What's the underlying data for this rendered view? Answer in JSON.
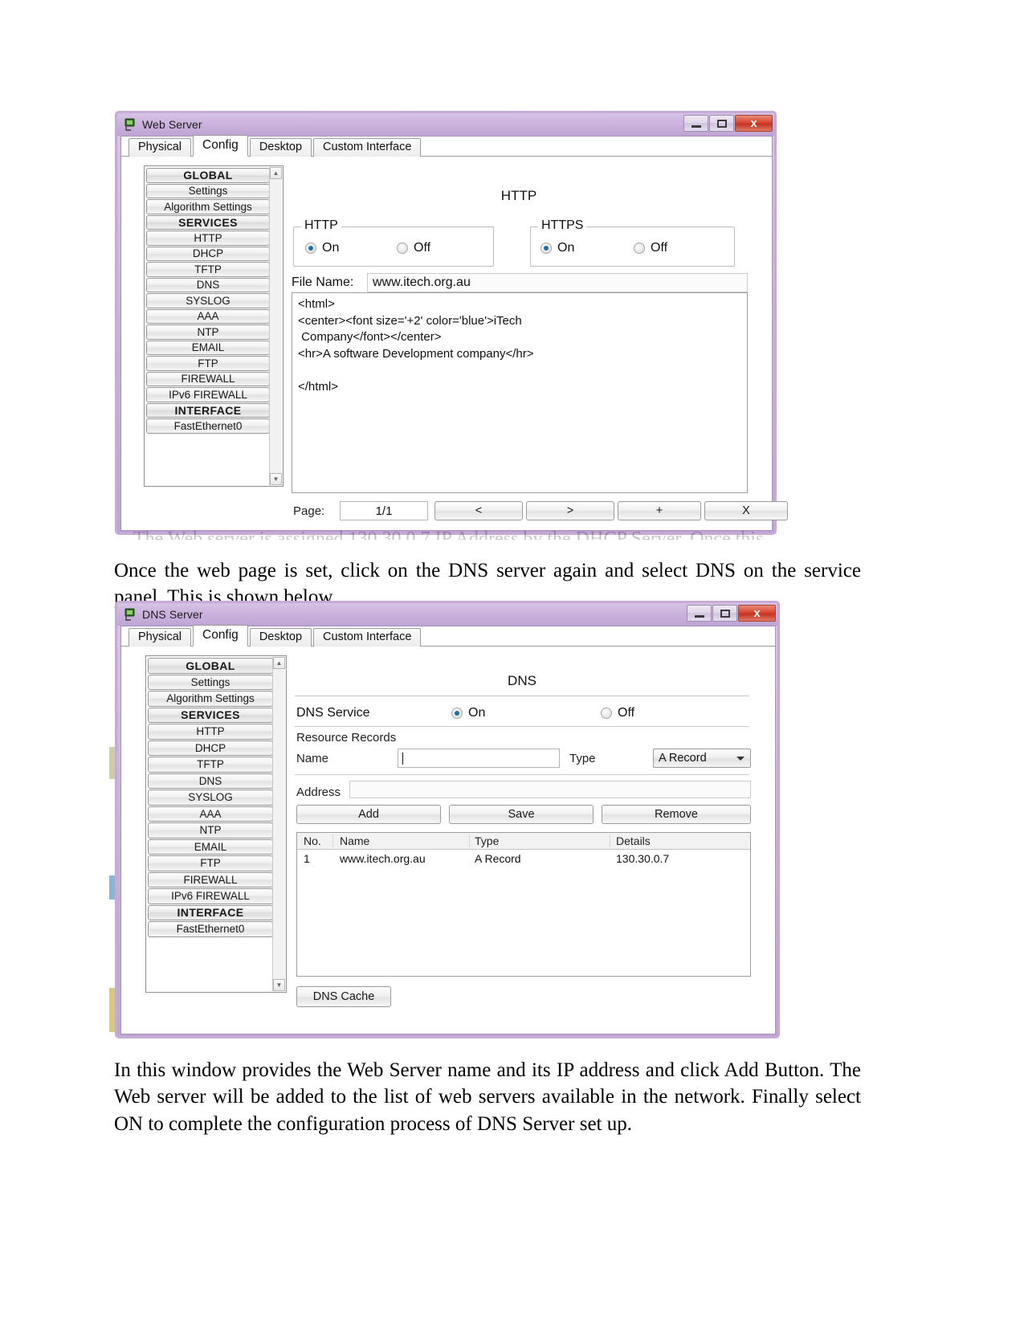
{
  "document": {
    "paragraph1": "Once the web page is set, click on the DNS server again and select DNS on the service panel. This is shown below.",
    "paragraph2": "In this window provides the Web Server name and its IP address and click Add Button. The Web server will be added to the list of web servers available in the network. Finally select ON to complete the configuration process of DNS Server set up."
  },
  "window1": {
    "title": "Web Server",
    "title_icon": "packet-tracer-device-icon",
    "titlebar_buttons": {
      "minimize": "minimize-icon",
      "maximize": "maximize-icon",
      "close": "x"
    },
    "tabs": [
      {
        "label": "Physical",
        "active": false
      },
      {
        "label": "Config",
        "active": true
      },
      {
        "label": "Desktop",
        "active": false
      },
      {
        "label": "Custom Interface",
        "active": false
      }
    ],
    "sidebar": [
      {
        "label": "GLOBAL",
        "header": true
      },
      {
        "label": "Settings",
        "header": false
      },
      {
        "label": "Algorithm Settings",
        "header": false
      },
      {
        "label": "SERVICES",
        "header": true
      },
      {
        "label": "HTTP",
        "header": false
      },
      {
        "label": "DHCP",
        "header": false
      },
      {
        "label": "TFTP",
        "header": false
      },
      {
        "label": "DNS",
        "header": false
      },
      {
        "label": "SYSLOG",
        "header": false
      },
      {
        "label": "AAA",
        "header": false
      },
      {
        "label": "NTP",
        "header": false
      },
      {
        "label": "EMAIL",
        "header": false
      },
      {
        "label": "FTP",
        "header": false
      },
      {
        "label": "FIREWALL",
        "header": false
      },
      {
        "label": "IPv6 FIREWALL",
        "header": false
      },
      {
        "label": "INTERFACE",
        "header": true
      },
      {
        "label": "FastEthernet0",
        "header": false
      }
    ],
    "panel": {
      "title": "HTTP",
      "http_group": {
        "legend": "HTTP",
        "on_label": "On",
        "off_label": "Off",
        "selected": "On"
      },
      "https_group": {
        "legend": "HTTPS",
        "on_label": "On",
        "off_label": "Off",
        "selected": "On"
      },
      "file_name_label": "File Name:",
      "file_name_value": "www.itech.org.au",
      "code": "<html>\n<center><font size='+2' color='blue'>iTech\n Company</font></center>\n<hr>A software Development company</hr>\n\n</html>",
      "page_label": "Page:",
      "page_value": "1/1",
      "prev_button": "<",
      "next_button": ">",
      "add_button": "+",
      "del_button": "X"
    }
  },
  "window2": {
    "title": "DNS Server",
    "title_icon": "packet-tracer-device-icon",
    "titlebar_buttons": {
      "minimize": "minimize-icon",
      "maximize": "maximize-icon",
      "close": "x"
    },
    "tabs": [
      {
        "label": "Physical",
        "active": false
      },
      {
        "label": "Config",
        "active": true
      },
      {
        "label": "Desktop",
        "active": false
      },
      {
        "label": "Custom Interface",
        "active": false
      }
    ],
    "sidebar": [
      {
        "label": "GLOBAL",
        "header": true
      },
      {
        "label": "Settings",
        "header": false
      },
      {
        "label": "Algorithm Settings",
        "header": false
      },
      {
        "label": "SERVICES",
        "header": true
      },
      {
        "label": "HTTP",
        "header": false
      },
      {
        "label": "DHCP",
        "header": false
      },
      {
        "label": "TFTP",
        "header": false
      },
      {
        "label": "DNS",
        "header": false
      },
      {
        "label": "SYSLOG",
        "header": false
      },
      {
        "label": "AAA",
        "header": false
      },
      {
        "label": "NTP",
        "header": false
      },
      {
        "label": "EMAIL",
        "header": false
      },
      {
        "label": "FTP",
        "header": false
      },
      {
        "label": "FIREWALL",
        "header": false
      },
      {
        "label": "IPv6 FIREWALL",
        "header": false
      },
      {
        "label": "INTERFACE",
        "header": true
      },
      {
        "label": "FastEthernet0",
        "header": false
      }
    ],
    "panel": {
      "title": "DNS",
      "service_label": "DNS Service",
      "on_label": "On",
      "off_label": "Off",
      "selected": "On",
      "resource_records_label": "Resource Records",
      "name_label": "Name",
      "name_value": "",
      "type_label": "Type",
      "type_value": "A Record",
      "address_label": "Address",
      "address_value": "",
      "add_button": "Add",
      "save_button": "Save",
      "remove_button": "Remove",
      "table": {
        "columns": [
          "No.",
          "Name",
          "Type",
          "Details"
        ],
        "rows": [
          [
            "1",
            "www.itech.org.au",
            "A Record",
            "130.30.0.7"
          ]
        ]
      },
      "dns_cache_button": "DNS Cache"
    }
  },
  "colors": {
    "titlebar_purple": "#c5abd6",
    "close_red": "#d9452f",
    "radio_blue": "#1d6fa5"
  }
}
